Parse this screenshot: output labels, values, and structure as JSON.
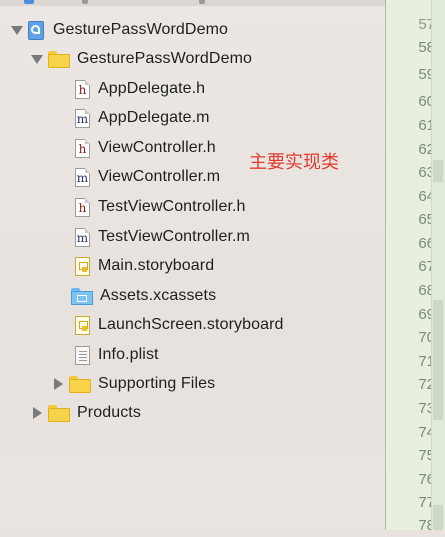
{
  "annotation": "主要实现类",
  "tree": {
    "project": "GesturePassWordDemo",
    "group": "GesturePassWordDemo",
    "files": [
      {
        "label": "AppDelegate.h",
        "icon_letter": "h"
      },
      {
        "label": "AppDelegate.m",
        "icon_letter": "m"
      },
      {
        "label": "ViewController.h",
        "icon_letter": "h"
      },
      {
        "label": "ViewController.m",
        "icon_letter": "m"
      },
      {
        "label": "TestViewController.h",
        "icon_letter": "h"
      },
      {
        "label": "TestViewController.m",
        "icon_letter": "m"
      },
      {
        "label": "Main.storyboard"
      },
      {
        "label": "Assets.xcassets"
      },
      {
        "label": "LaunchScreen.storyboard"
      },
      {
        "label": "Info.plist"
      }
    ],
    "supporting_files": "Supporting Files",
    "products": "Products"
  },
  "gutter": {
    "line_numbers": [
      "57",
      "58",
      "59",
      "60",
      "61",
      "62",
      "63",
      "64",
      "65",
      "66",
      "67",
      "68",
      "69",
      "70",
      "71",
      "72",
      "73",
      "74",
      "75",
      "76",
      "77",
      "78"
    ]
  },
  "colors": {
    "annotation": "#e23a2e",
    "header_file": "#8b1a1a",
    "implementation_file": "#2e2e6e",
    "folder": "#f8d34a",
    "gutter_background": "#e7f0df"
  },
  "icons": {
    "project": "xcode-project-icon",
    "folder": "folder-icon",
    "header": "header-file-icon",
    "implementation": "implementation-file-icon",
    "storyboard": "storyboard-file-icon",
    "assets": "asset-catalog-icon",
    "plist": "plist-file-icon"
  }
}
